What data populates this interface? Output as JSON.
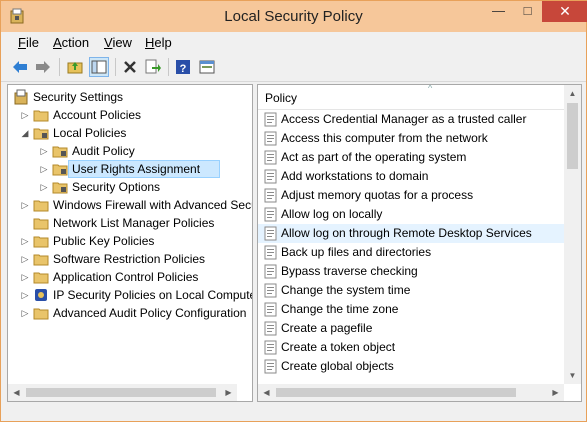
{
  "window": {
    "title": "Local Security Policy"
  },
  "menu": [
    "File",
    "Edit",
    "View",
    "Help"
  ],
  "toolbar": {
    "buttons": [
      "back-arrow-icon",
      "forward-arrow-icon",
      "up-folder-icon",
      "show-tree-icon",
      "delete-icon",
      "export-list-icon",
      "help-icon",
      "properties-icon"
    ]
  },
  "tree": {
    "root": "Security Settings",
    "items": [
      {
        "label": "Account Policies",
        "level": 1,
        "expander": "collapsed",
        "icon": "folder-icon"
      },
      {
        "label": "Local Policies",
        "level": 1,
        "expander": "expanded",
        "icon": "folder-icon"
      },
      {
        "label": "Audit Policy",
        "level": 2,
        "expander": "collapsed",
        "icon": "folder-icon"
      },
      {
        "label": "User Rights Assignment",
        "level": 2,
        "expander": "collapsed",
        "icon": "folder-icon",
        "selected": true
      },
      {
        "label": "Security Options",
        "level": 2,
        "expander": "collapsed",
        "icon": "folder-icon"
      },
      {
        "label": "Windows Firewall with Advanced Secu",
        "level": 1,
        "expander": "collapsed",
        "icon": "folder-icon"
      },
      {
        "label": "Network List Manager Policies",
        "level": 1,
        "expander": "none",
        "icon": "folder-icon"
      },
      {
        "label": "Public Key Policies",
        "level": 1,
        "expander": "collapsed",
        "icon": "folder-icon"
      },
      {
        "label": "Software Restriction Policies",
        "level": 1,
        "expander": "collapsed",
        "icon": "folder-icon"
      },
      {
        "label": "Application Control Policies",
        "level": 1,
        "expander": "collapsed",
        "icon": "folder-icon"
      },
      {
        "label": "IP Security Policies on Local Compute",
        "level": 1,
        "expander": "collapsed",
        "icon": "ipsec-icon"
      },
      {
        "label": "Advanced Audit Policy Configuration",
        "level": 1,
        "expander": "collapsed",
        "icon": "folder-icon"
      }
    ]
  },
  "list": {
    "column": "Policy",
    "rows": [
      "Access Credential Manager as a trusted caller",
      "Access this computer from the network",
      "Act as part of the operating system",
      "Add workstations to domain",
      "Adjust memory quotas for a process",
      "Allow log on locally",
      "Allow log on through Remote Desktop Services",
      "Back up files and directories",
      "Bypass traverse checking",
      "Change the system time",
      "Change the time zone",
      "Create a pagefile",
      "Create a token object",
      "Create global objects"
    ],
    "highlighted": "Allow log on through Remote Desktop Services"
  },
  "colors": {
    "titlebar": "#f6c79a",
    "close": "#c7473a",
    "selection": "#cce8ff",
    "hover": "#e5f3ff"
  }
}
